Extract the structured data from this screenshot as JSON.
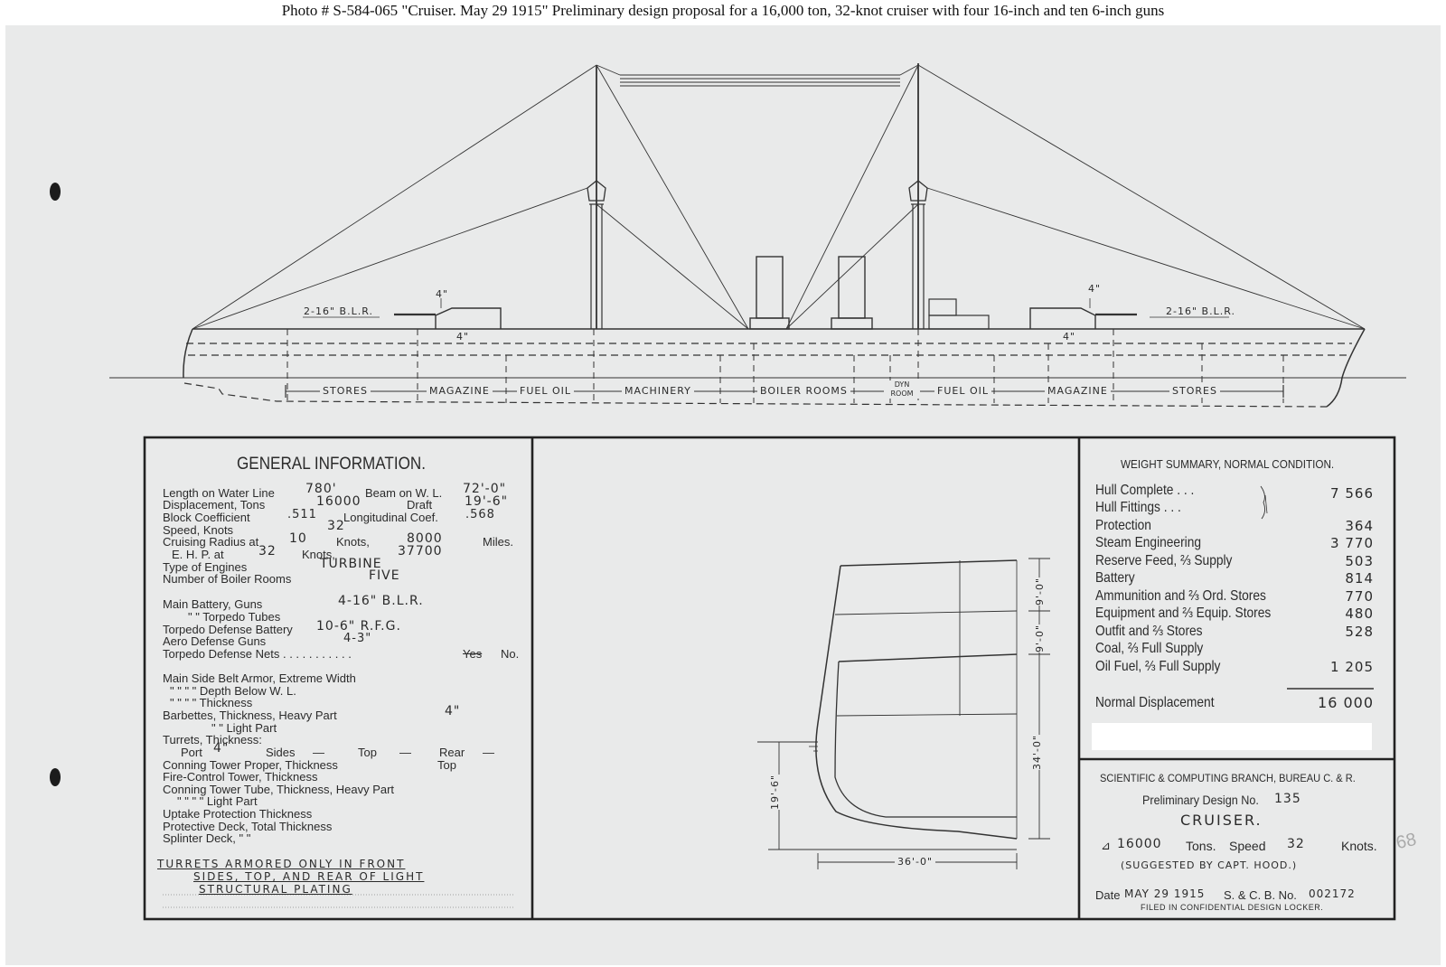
{
  "caption": "Photo #  S-584-065   \"Cruiser.  May 29 1915\"   Preliminary design proposal for a 16,000 ton, 32-knot cruiser with four 16-inch and ten 6-inch guns",
  "profile": {
    "gun_label_fwd": "2-16\" B.L.R.",
    "gun_label_aft": "2-16\" B.L.R.",
    "armor_mark_fwd": "4\"",
    "armor_mark_aft": "4\"",
    "belt_mark_fwd": "4\"",
    "belt_mark_aft": "4\"",
    "compartments": [
      "STORES",
      "MAGAZINE",
      "FUEL OIL",
      "MACHINERY",
      "BOILER ROOMS",
      "DYN ROOM",
      "FUEL OIL",
      "MAGAZINE",
      "STORES"
    ]
  },
  "general_information": {
    "title": "GENERAL INFORMATION.",
    "lines": [
      {
        "label": "Length on Water Line",
        "value": "780'",
        "label2": "Beam on W. L.",
        "value2": "72'-0\""
      },
      {
        "label": "Displacement, Tons",
        "value": "16000",
        "label2": "Draft",
        "value2": "19'-6\""
      },
      {
        "label": "Block Coefficient",
        "value": ".511",
        "label2": "Longitudinal Coef.",
        "value2": ".568"
      },
      {
        "label": "Speed, Knots",
        "value": "32"
      },
      {
        "label": "Cruising Radius at",
        "value": "10",
        "label2": "Knots,",
        "value2": "8000",
        "suffix": "Miles."
      },
      {
        "label": "E. H. P. at",
        "value": "32",
        "label2": "Knots,",
        "value2": "37700"
      },
      {
        "label": "Type of Engines",
        "value": "TURBINE"
      },
      {
        "label": "Number of Boiler Rooms",
        "value": "FIVE"
      },
      {
        "label": "Main Battery, Guns",
        "value": "4-16\" B.L.R."
      },
      {
        "label": "\"      \"     Torpedo Tubes",
        "value": ""
      },
      {
        "label": "Torpedo Defense Battery",
        "value": "10-6\" R.F.G."
      },
      {
        "label": "Aero Defense Guns",
        "value": "4-3\""
      },
      {
        "label": "Torpedo Defense Nets . . . . . . . . . . .",
        "value": "Yes",
        "suffix": "No."
      },
      {
        "label": "Main Side Belt Armor, Extreme Width",
        "value": ""
      },
      {
        "label": "\"     \"     \"     \"     Depth Below W. L.",
        "value": ""
      },
      {
        "label": "\"     \"     \"     \"     Thickness",
        "value": ""
      },
      {
        "label": "Barbettes, Thickness, Heavy Part",
        "value": "4\""
      },
      {
        "label": "\"          \"          Light Part",
        "value": ""
      },
      {
        "label": "Turrets, Thickness:",
        "value": ""
      },
      {
        "label": "Port",
        "value": "4\"",
        "label2": "Sides",
        "value2": "—",
        "label3": "Top",
        "value3": "—",
        "label4": "Rear",
        "value4": "—"
      },
      {
        "label": "Conning Tower Proper, Thickness",
        "value": "",
        "label2": "Top"
      },
      {
        "label": "Fire-Control Tower, Thickness",
        "value": ""
      },
      {
        "label": "Conning Tower Tube, Thickness, Heavy Part",
        "value": ""
      },
      {
        "label": "\"     \"     \"     \"     Light Part",
        "value": ""
      },
      {
        "label": "Uptake Protection Thickness",
        "value": ""
      },
      {
        "label": "Protective Deck, Total Thickness",
        "value": ""
      },
      {
        "label": "Splinter Deck,     \"          \"",
        "value": ""
      }
    ],
    "note_lines": [
      "TURRETS ARMORED ONLY IN FRONT",
      "SIDES, TOP, AND REAR OF LIGHT",
      "STRUCTURAL PLATING"
    ]
  },
  "midship_section": {
    "dim_upper_1": "9'-0\"",
    "dim_upper_2": "9'-0\"",
    "dim_depth": "34'-0\"",
    "dim_draft": "19'-6\"",
    "dim_half_beam": "36'-0\""
  },
  "weight_summary": {
    "title": "WEIGHT SUMMARY, NORMAL CONDITION.",
    "rows": [
      {
        "label": "Hull Complete  .  .  .",
        "value": "7 566"
      },
      {
        "label": "Hull Fittings  .  .  .",
        "value": ""
      },
      {
        "label": "Protection",
        "value": "364"
      },
      {
        "label": "Steam Engineering",
        "value": "3 770"
      },
      {
        "label": "Reserve Feed, ⅔ Supply",
        "value": "503"
      },
      {
        "label": "Battery",
        "value": "814"
      },
      {
        "label": "Ammunition and ⅔ Ord. Stores",
        "value": "770"
      },
      {
        "label": "Equipment and ⅔ Equip. Stores",
        "value": "480"
      },
      {
        "label": "Outfit and ⅔ Stores",
        "value": "528"
      },
      {
        "label": "Coal, ⅔ Full Supply",
        "value": ""
      },
      {
        "label": "Oil Fuel, ⅔ Full Supply",
        "value": "1 205"
      }
    ],
    "total_label": "Normal Displacement",
    "total_value": "16 000"
  },
  "title_block": {
    "branch": "SCIENTIFIC & COMPUTING BRANCH, BUREAU C. & R.",
    "design_label": "Preliminary Design No.",
    "design_no": "135",
    "type": "CRUISER.",
    "tons_prefix": "⊿",
    "tons_value": "16000",
    "tons_label": "Tons.",
    "speed_label": "Speed",
    "speed_value": "32",
    "knots_label": "Knots.",
    "suggested": "(SUGGESTED BY CAPT. HOOD.)",
    "date_label": "Date",
    "date_value": "MAY 29 1915",
    "scb_label": "S. & C. B. No.",
    "scb_value": "002172",
    "filed": "FILED IN CONFIDENTIAL DESIGN LOCKER."
  },
  "margin_mark": "68"
}
